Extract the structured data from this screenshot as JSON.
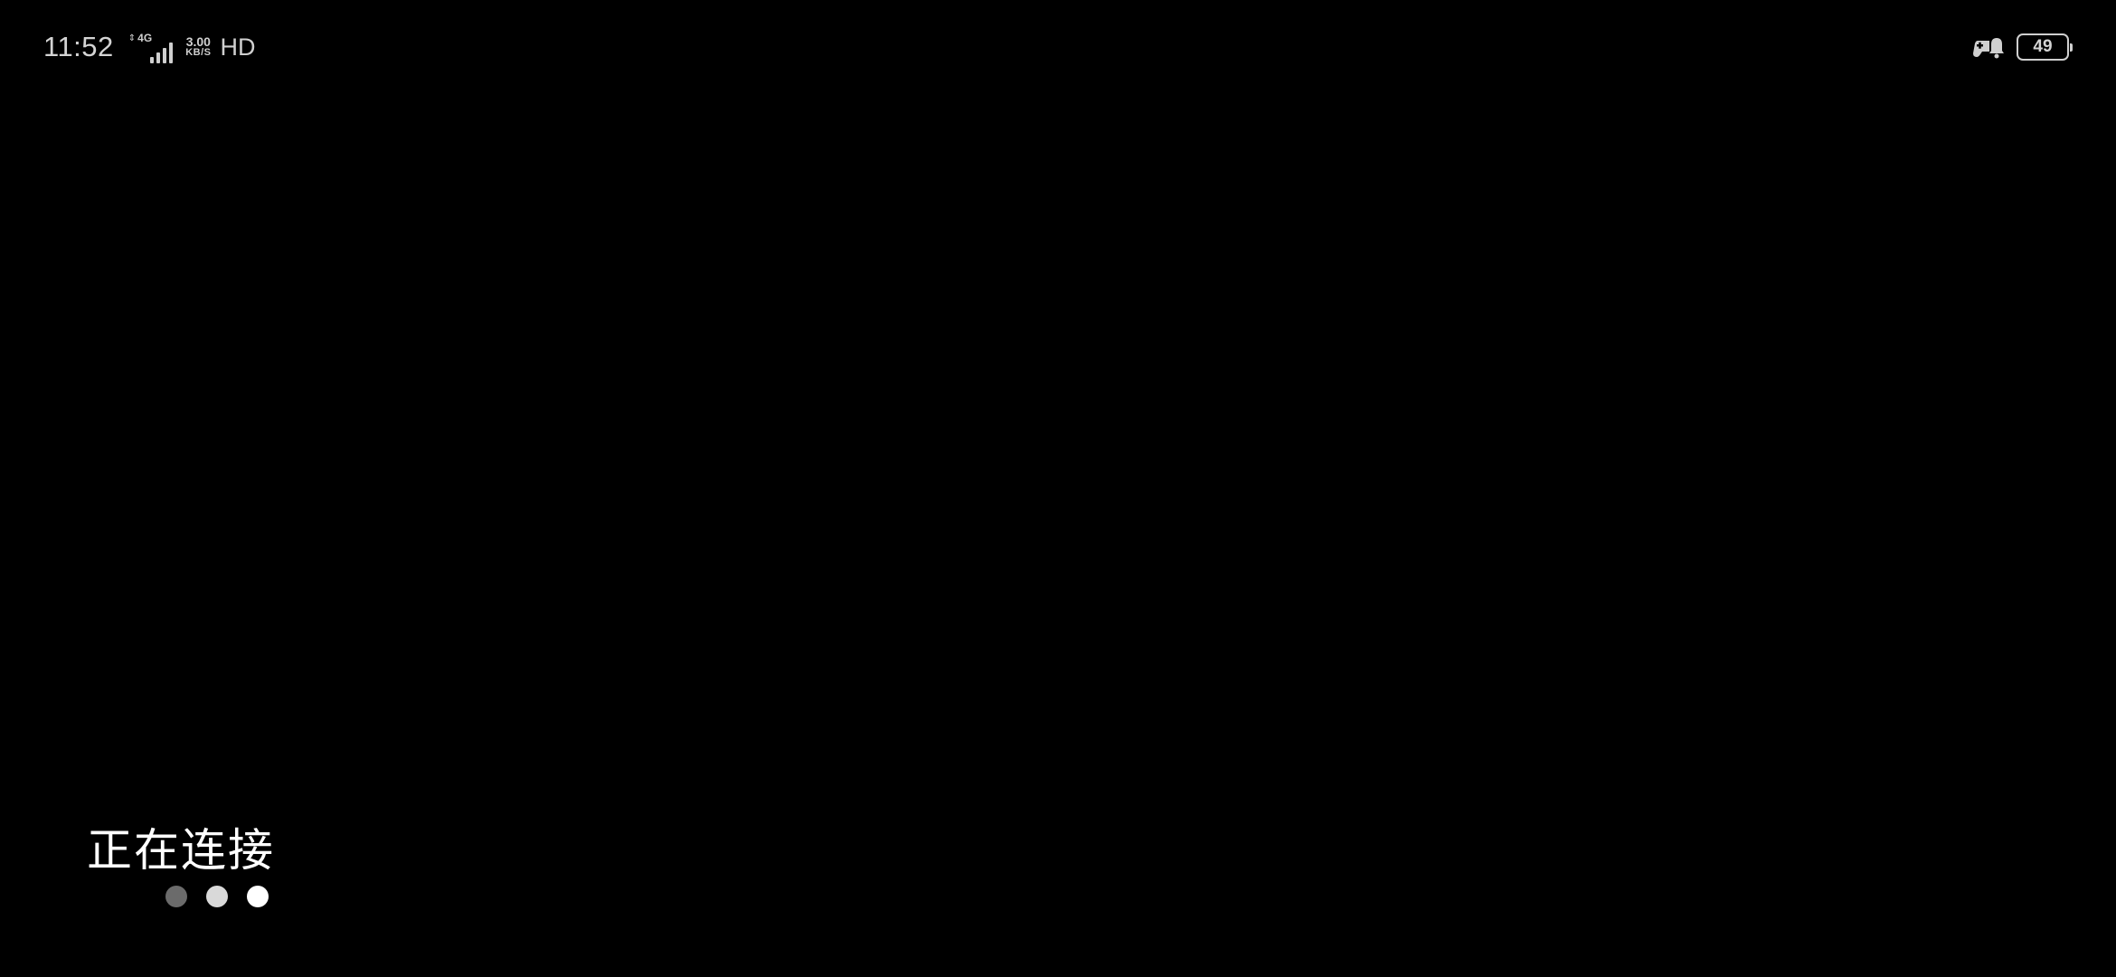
{
  "status_bar": {
    "time": "11:52",
    "network_type": "4G",
    "network_speed_value": "3.00",
    "network_speed_unit": "KB/S",
    "hd_label": "HD",
    "signal_icon": "cellular-signal-icon",
    "game_mode_icon": "gamepad-icon",
    "battery_level": "49"
  },
  "connection": {
    "status_text": "正在连接",
    "dots": [
      {
        "color": "#6b6b6b"
      },
      {
        "color": "#d9d9d9"
      },
      {
        "color": "#ffffff"
      }
    ]
  }
}
